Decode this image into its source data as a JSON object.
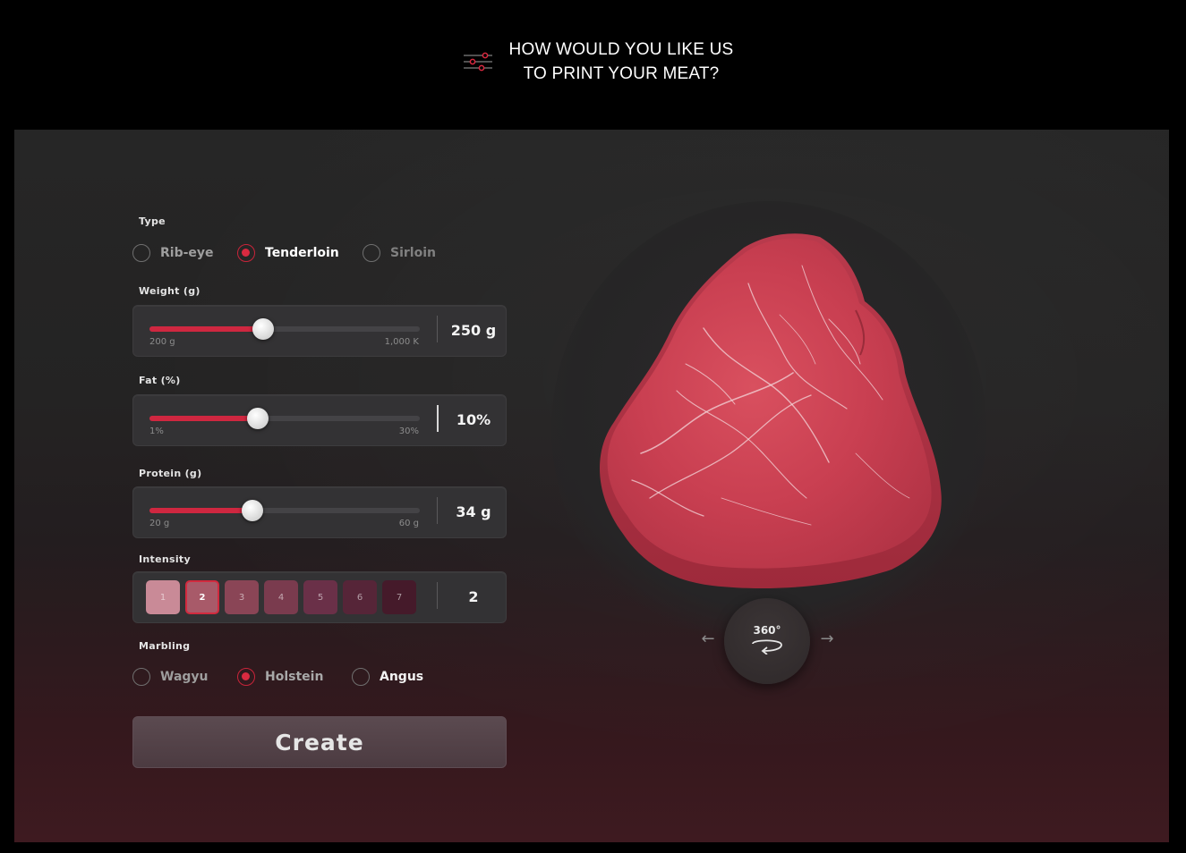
{
  "header": {
    "title_line1": "HOW WOULD YOU LIKE US",
    "title_line2": "TO PRINT YOUR MEAT?",
    "icon": "sliders-icon"
  },
  "form": {
    "type": {
      "label": "Type",
      "options": [
        "Rib-eye",
        "Tenderloin",
        "Sirloin"
      ],
      "selected": "Tenderloin"
    },
    "weight": {
      "label": "Weight (g)",
      "min_label": "200 g",
      "max_label": "1,000 K",
      "value_display": "250 g",
      "fill_fraction": 0.42
    },
    "fat": {
      "label": "Fat (%)",
      "min_label": "1%",
      "max_label": "30%",
      "value_display": "10%",
      "fill_fraction": 0.4
    },
    "protein": {
      "label": "Protein (g)",
      "min_label": "20 g",
      "max_label": "60 g",
      "value_display": "34 g",
      "fill_fraction": 0.38
    },
    "intensity": {
      "label": "Intensity",
      "levels": [
        "1",
        "2",
        "3",
        "4",
        "5",
        "6",
        "7"
      ],
      "colors": [
        "#c98a97",
        "#a85a69",
        "#8a4556",
        "#7a3b4e",
        "#6a3048",
        "#562538",
        "#451a2a"
      ],
      "selected": "2",
      "value_display": "2"
    },
    "marbling": {
      "label": "Marbling",
      "options": [
        "Wagyu",
        "Holstein",
        "Angus"
      ],
      "selected": "Holstein"
    },
    "create_label": "Create"
  },
  "viewer": {
    "rotate_label": "360°",
    "prev_arrow": "arrow-left-icon",
    "next_arrow": "arrow-right-icon"
  },
  "colors": {
    "accent": "#cf2740",
    "background": "#000000"
  }
}
